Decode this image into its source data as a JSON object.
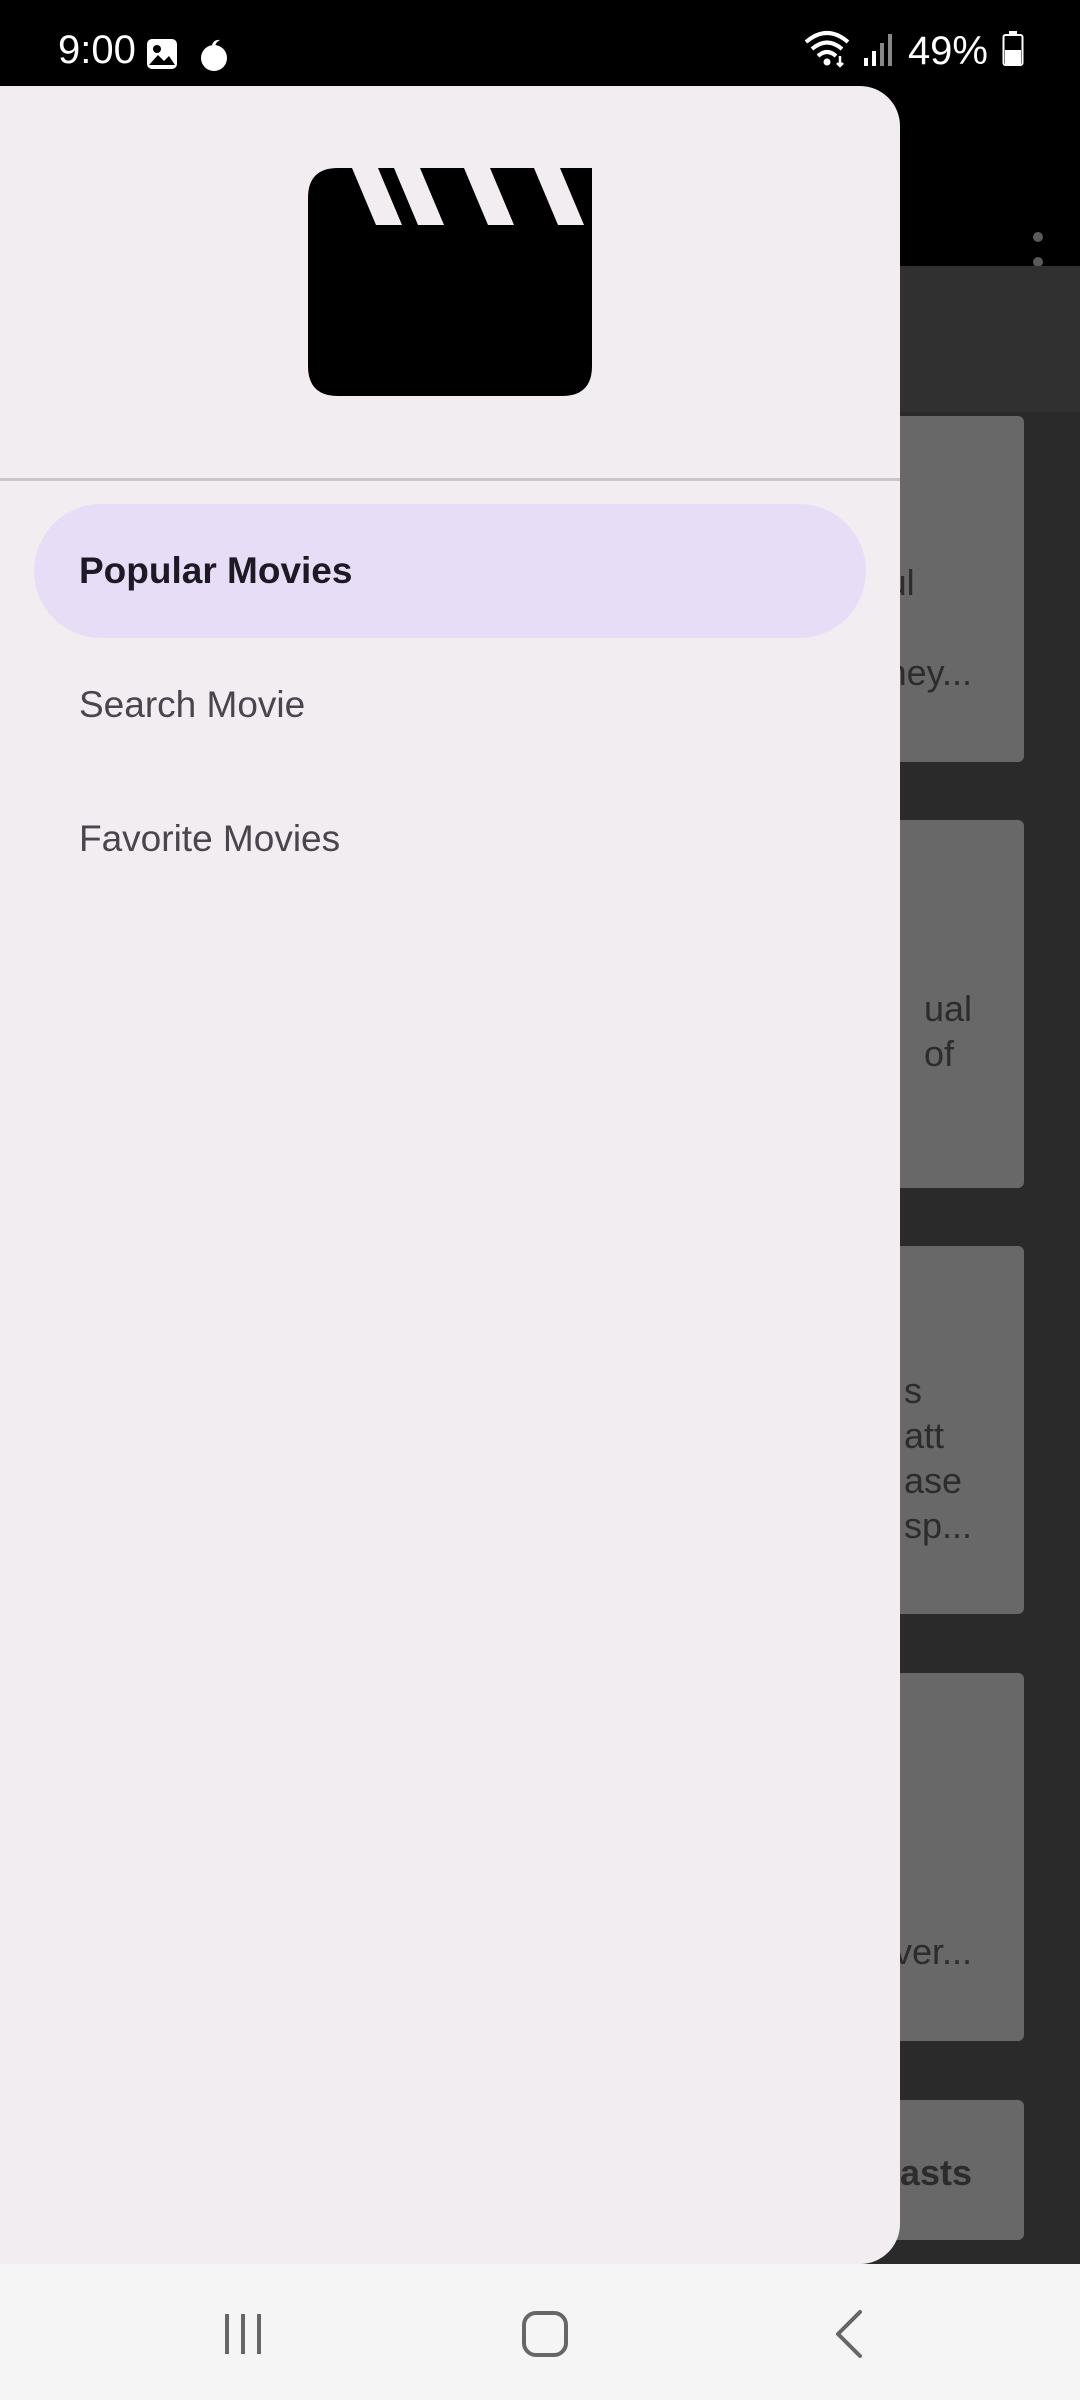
{
  "status_bar": {
    "time": "9:00",
    "battery": "49%",
    "icons": [
      "gallery-icon",
      "notification-icon",
      "wifi-icon",
      "signal-icon",
      "battery-icon"
    ]
  },
  "drawer": {
    "header_icon": "clapperboard-icon",
    "items": [
      {
        "label": "Popular Movies",
        "active": true
      },
      {
        "label": "Search Movie",
        "active": false
      },
      {
        "label": "Favorite Movies",
        "active": false
      }
    ]
  },
  "background": {
    "overflow_icon": "more-vert-icon",
    "cards": [
      {
        "text": "ul\nf\nney..."
      },
      {
        "text": "ual\nof"
      },
      {
        "text": "s\natt\nase\nsp..."
      },
      {
        "text": "ver..."
      },
      {
        "text": "asts"
      }
    ]
  },
  "nav_bar": {
    "buttons": [
      "recents-icon",
      "home-icon",
      "back-icon"
    ]
  },
  "colors": {
    "drawer_bg": "#f2edf1",
    "active_item_bg": "#e7ddf7",
    "scrim": "#2a2a2a",
    "card": "#686868"
  }
}
